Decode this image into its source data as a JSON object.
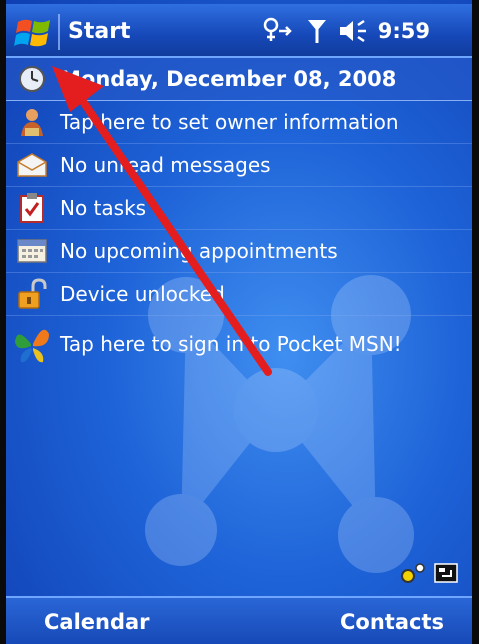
{
  "titlebar": {
    "start_label": "Start",
    "time": "9:59",
    "icons": [
      "windows-flag-icon",
      "connectivity-icon",
      "signal-icon",
      "speaker-icon"
    ]
  },
  "today": {
    "items": [
      {
        "icon": "clock-icon",
        "label": "Monday, December 08, 2008"
      },
      {
        "icon": "owner-icon",
        "label": "Tap here to set owner information"
      },
      {
        "icon": "envelope-icon",
        "label": "No unread messages"
      },
      {
        "icon": "tasks-icon",
        "label": "No tasks"
      },
      {
        "icon": "calendar-icon",
        "label": "No upcoming appointments"
      },
      {
        "icon": "padlock-icon",
        "label": "Device unlocked"
      },
      {
        "icon": "msn-butterfly-icon",
        "label": "Tap here to sign in to Pocket MSN!"
      }
    ]
  },
  "softkeys": {
    "left": "Calendar",
    "right": "Contacts"
  },
  "colors": {
    "annotation_arrow": "#e41e1e",
    "background_blue": "#1e63d8"
  }
}
